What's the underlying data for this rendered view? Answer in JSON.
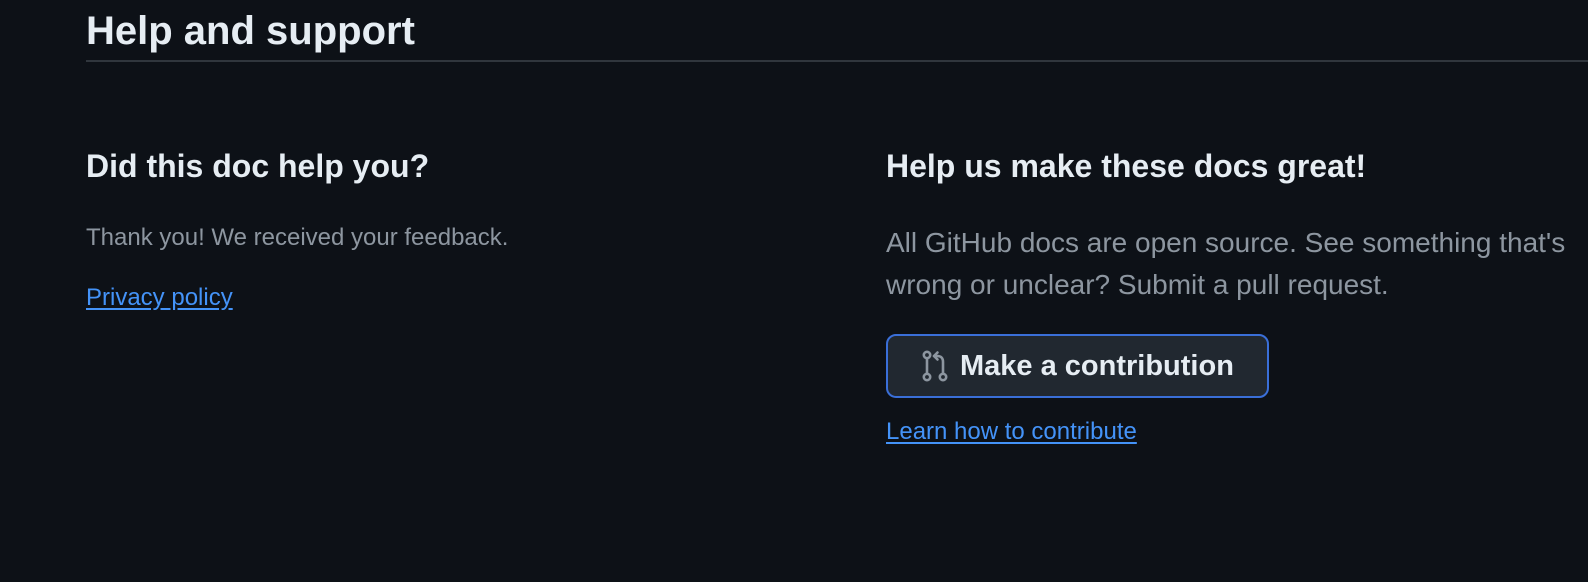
{
  "section": {
    "title": "Help and support"
  },
  "feedback": {
    "heading": "Did this doc help you?",
    "message": "Thank you! We received your feedback.",
    "privacy_link": "Privacy policy"
  },
  "contribute": {
    "heading": "Help us make these docs great!",
    "description": "All GitHub docs are open source. See something that's wrong or unclear? Submit a pull request.",
    "button_label": "Make a contribution",
    "button_icon": "git-pull-request-icon",
    "learn_link": "Learn how to contribute"
  },
  "colors": {
    "background": "#0d1117",
    "heading": "#e6edf3",
    "muted_text": "#8d96a0",
    "link": "#4493f8",
    "button_border": "#3a6fd8",
    "button_bg": "#212830"
  }
}
